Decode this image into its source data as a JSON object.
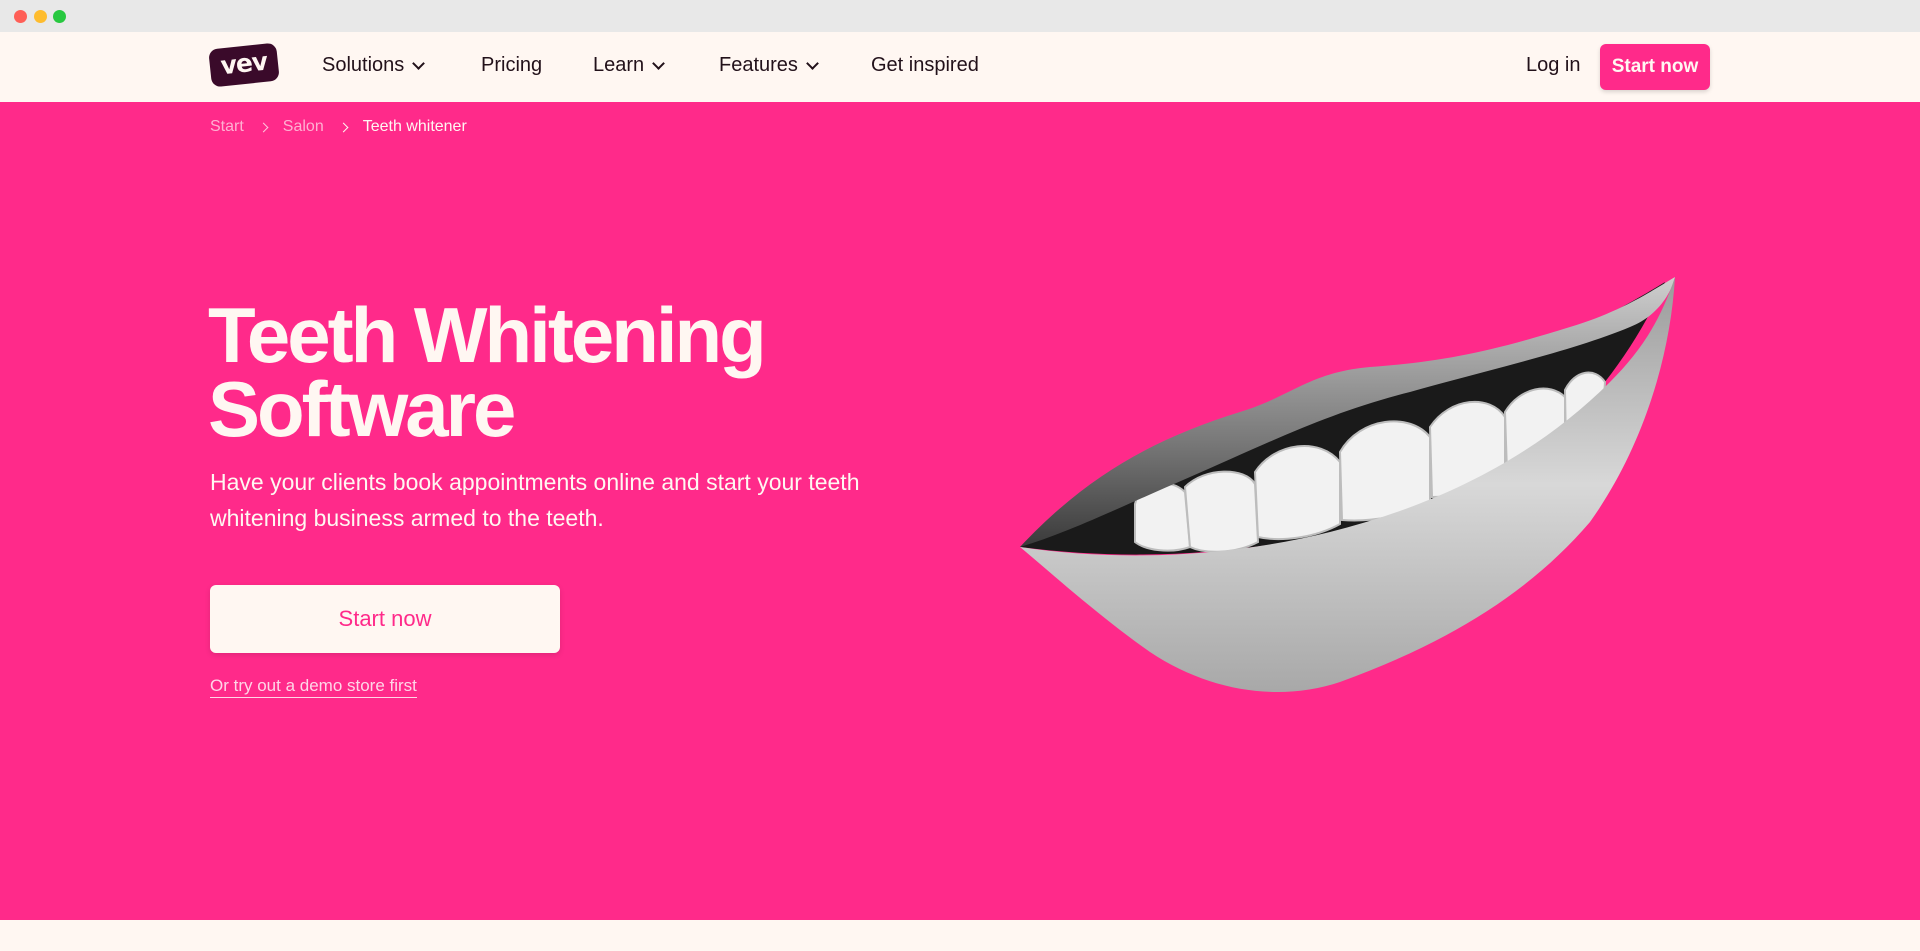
{
  "nav": {
    "logo_text": "vev",
    "items": [
      {
        "label": "Solutions",
        "dropdown": true
      },
      {
        "label": "Pricing",
        "dropdown": false
      },
      {
        "label": "Learn",
        "dropdown": true
      },
      {
        "label": "Features",
        "dropdown": true
      },
      {
        "label": "Get inspired",
        "dropdown": false
      }
    ],
    "login_label": "Log in",
    "cta_label": "Start now"
  },
  "breadcrumb": {
    "items": [
      "Start",
      "Salon"
    ],
    "current": "Teeth whitener"
  },
  "hero": {
    "title_line1": "Teeth Whitening",
    "title_line2": "Software",
    "subtitle": "Have your clients book appointments online and start your teeth whitening business armed to the teeth.",
    "cta_label": "Start now",
    "demo_link": "Or try out a demo store first"
  },
  "colors": {
    "brand_pink": "#ff2a8a",
    "cream": "#fff7f2",
    "logo_dark": "#3a0a2a"
  }
}
